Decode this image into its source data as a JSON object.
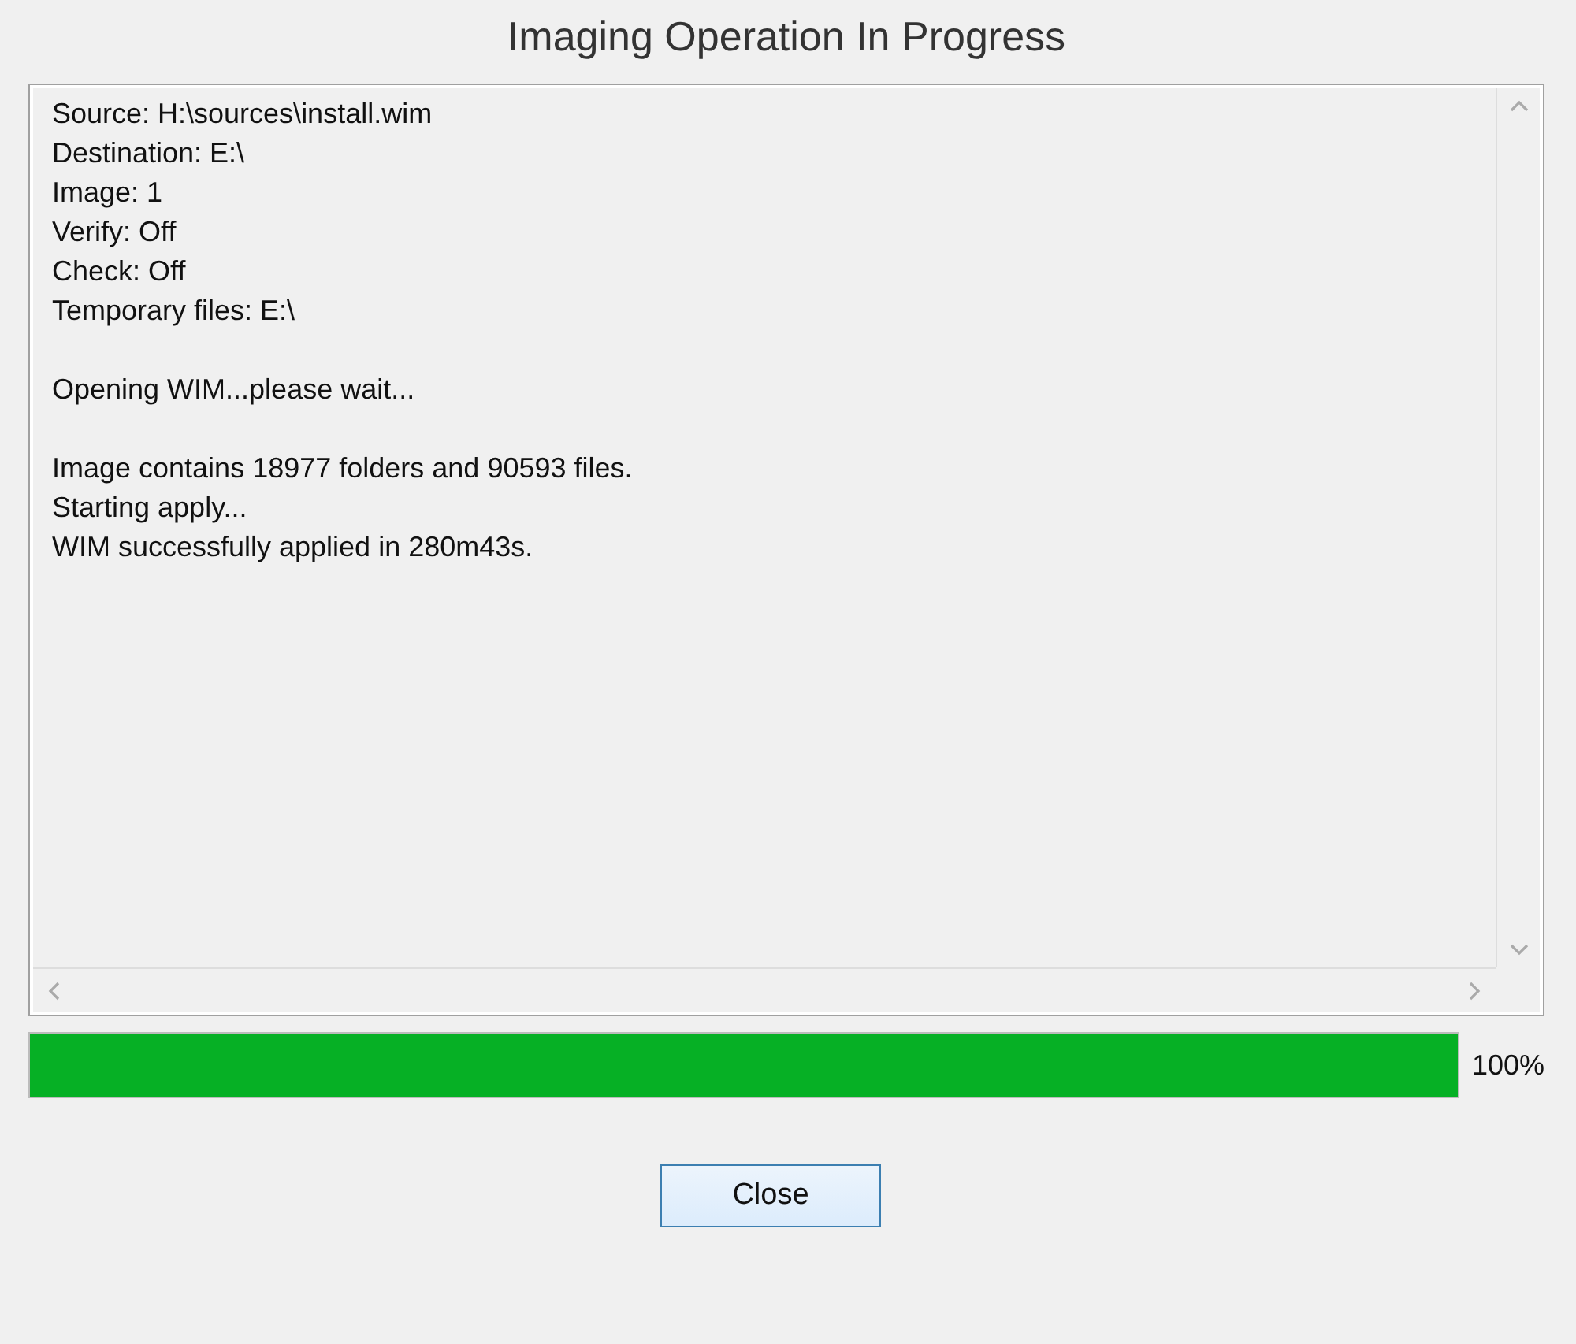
{
  "window": {
    "title": "Imaging Operation In Progress"
  },
  "log": {
    "blocks": [
      [
        "Source: H:\\sources\\install.wim",
        "Destination: E:\\",
        "Image: 1",
        "Verify: Off",
        "Check: Off",
        "Temporary files: E:\\"
      ],
      [
        "Opening WIM...please wait..."
      ],
      [
        "Image contains 18977 folders and 90593 files.",
        "Starting apply...",
        "WIM successfully applied in 280m43s."
      ]
    ]
  },
  "progress": {
    "level": 1,
    "reading": "100%"
  },
  "buttons": [
    {
      "label": "Close"
    }
  ]
}
